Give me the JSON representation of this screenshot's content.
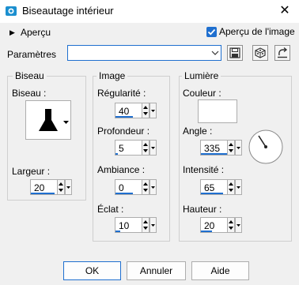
{
  "window": {
    "title": "Biseautage intérieur"
  },
  "preview": {
    "label": "Aperçu",
    "checkbox_label": "Aperçu de l'image",
    "checked": true
  },
  "params": {
    "label": "Paramètres",
    "preset_value": ""
  },
  "bevel": {
    "group_title": "Biseau",
    "bevel_label": "Biseau :",
    "width_label": "Largeur :",
    "width_value": "20"
  },
  "image": {
    "group_title": "Image",
    "smoothness_label": "Régularité :",
    "smoothness_value": "40",
    "depth_label": "Profondeur :",
    "depth_value": "5",
    "ambience_label": "Ambiance :",
    "ambience_value": "0",
    "shininess_label": "Éclat :",
    "shininess_value": "10"
  },
  "light": {
    "group_title": "Lumière",
    "color_label": "Couleur :",
    "color_value": "#ffffff",
    "angle_label": "Angle :",
    "angle_value": "335",
    "intensity_label": "Intensité :",
    "intensity_value": "65",
    "height_label": "Hauteur :",
    "height_value": "20"
  },
  "buttons": {
    "ok": "OK",
    "cancel": "Annuler",
    "help": "Aide"
  },
  "colors": {
    "accent": "#1f6fcf"
  },
  "icons": [
    "app-icon",
    "close-icon",
    "expand-triangle-icon",
    "checkmark-icon",
    "save-preset-icon",
    "random-icon",
    "reset-icon",
    "bevel-shape-icon",
    "angle-dial-icon"
  ]
}
